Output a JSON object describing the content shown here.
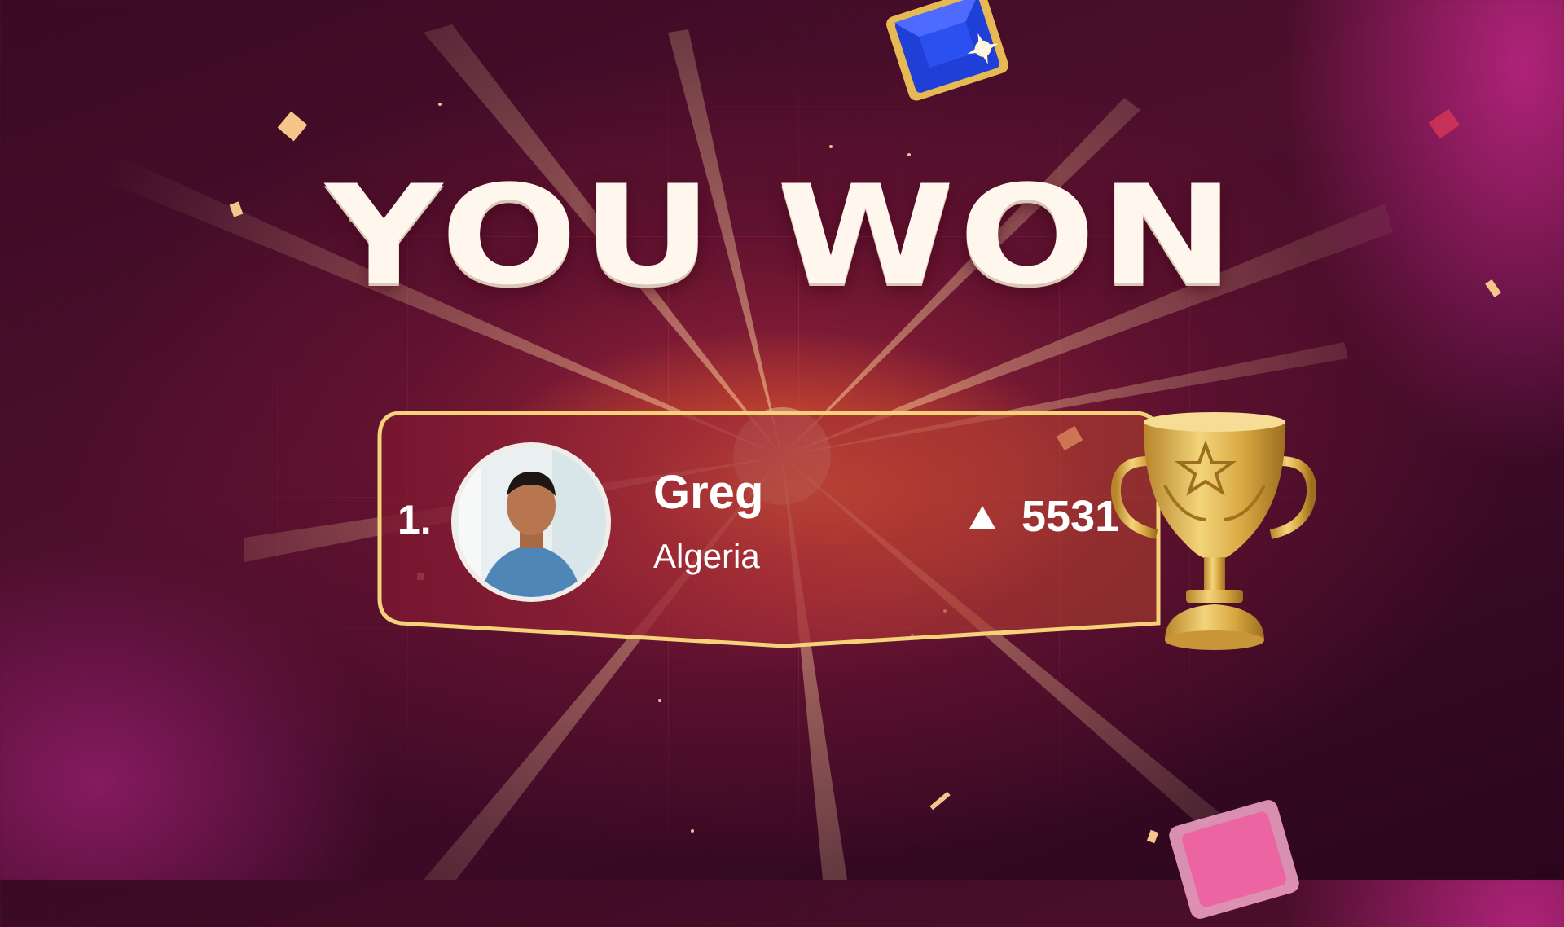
{
  "title": "YOU WON",
  "result": {
    "rank": "1.",
    "player_name": "Greg",
    "country": "Algeria",
    "score": "5531"
  },
  "icons": {
    "score_trend": "up-triangle-icon",
    "trophy": "trophy-icon",
    "gems": [
      "blue-gem-icon",
      "pink-gem-icon"
    ]
  },
  "colors": {
    "card_border": "#f3d27a",
    "title_text": "#fff7ee",
    "background": "#3a0a24",
    "glow": "#ff9628"
  }
}
